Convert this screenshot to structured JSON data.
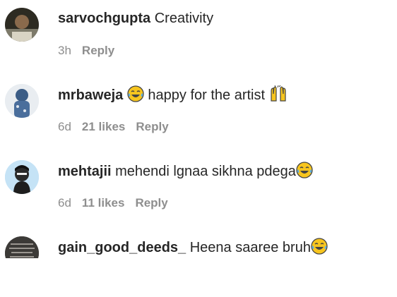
{
  "comments": [
    {
      "username": "sarvochgupta",
      "text": "Creativity",
      "time": "3h",
      "likes": "",
      "reply_label": "Reply",
      "avatar_icon": "user-avatar"
    },
    {
      "username": "mrbaweja",
      "text_before": "happy for the artist",
      "leading_emoji": "face-with-tears-of-joy-icon",
      "trailing_emoji": "raising-hands-icon",
      "time": "6d",
      "likes": "21 likes",
      "reply_label": "Reply",
      "avatar_icon": "user-avatar"
    },
    {
      "username": "mehtajii",
      "text": "mehendi lgnaa sikhna pdega",
      "trailing_emoji": "face-with-tears-of-joy-icon",
      "time": "6d",
      "likes": "11 likes",
      "reply_label": "Reply",
      "avatar_icon": "user-avatar"
    },
    {
      "username": "gain_good_deeds_",
      "text": "Heena saaree bruh",
      "trailing_emoji": "face-with-tears-of-joy-icon",
      "avatar_icon": "user-avatar"
    }
  ],
  "colors": {
    "text": "#262626",
    "meta": "#8e8e8e",
    "emoji_yellow": "#f7c51e",
    "emoji_tear": "#5aaee8"
  }
}
